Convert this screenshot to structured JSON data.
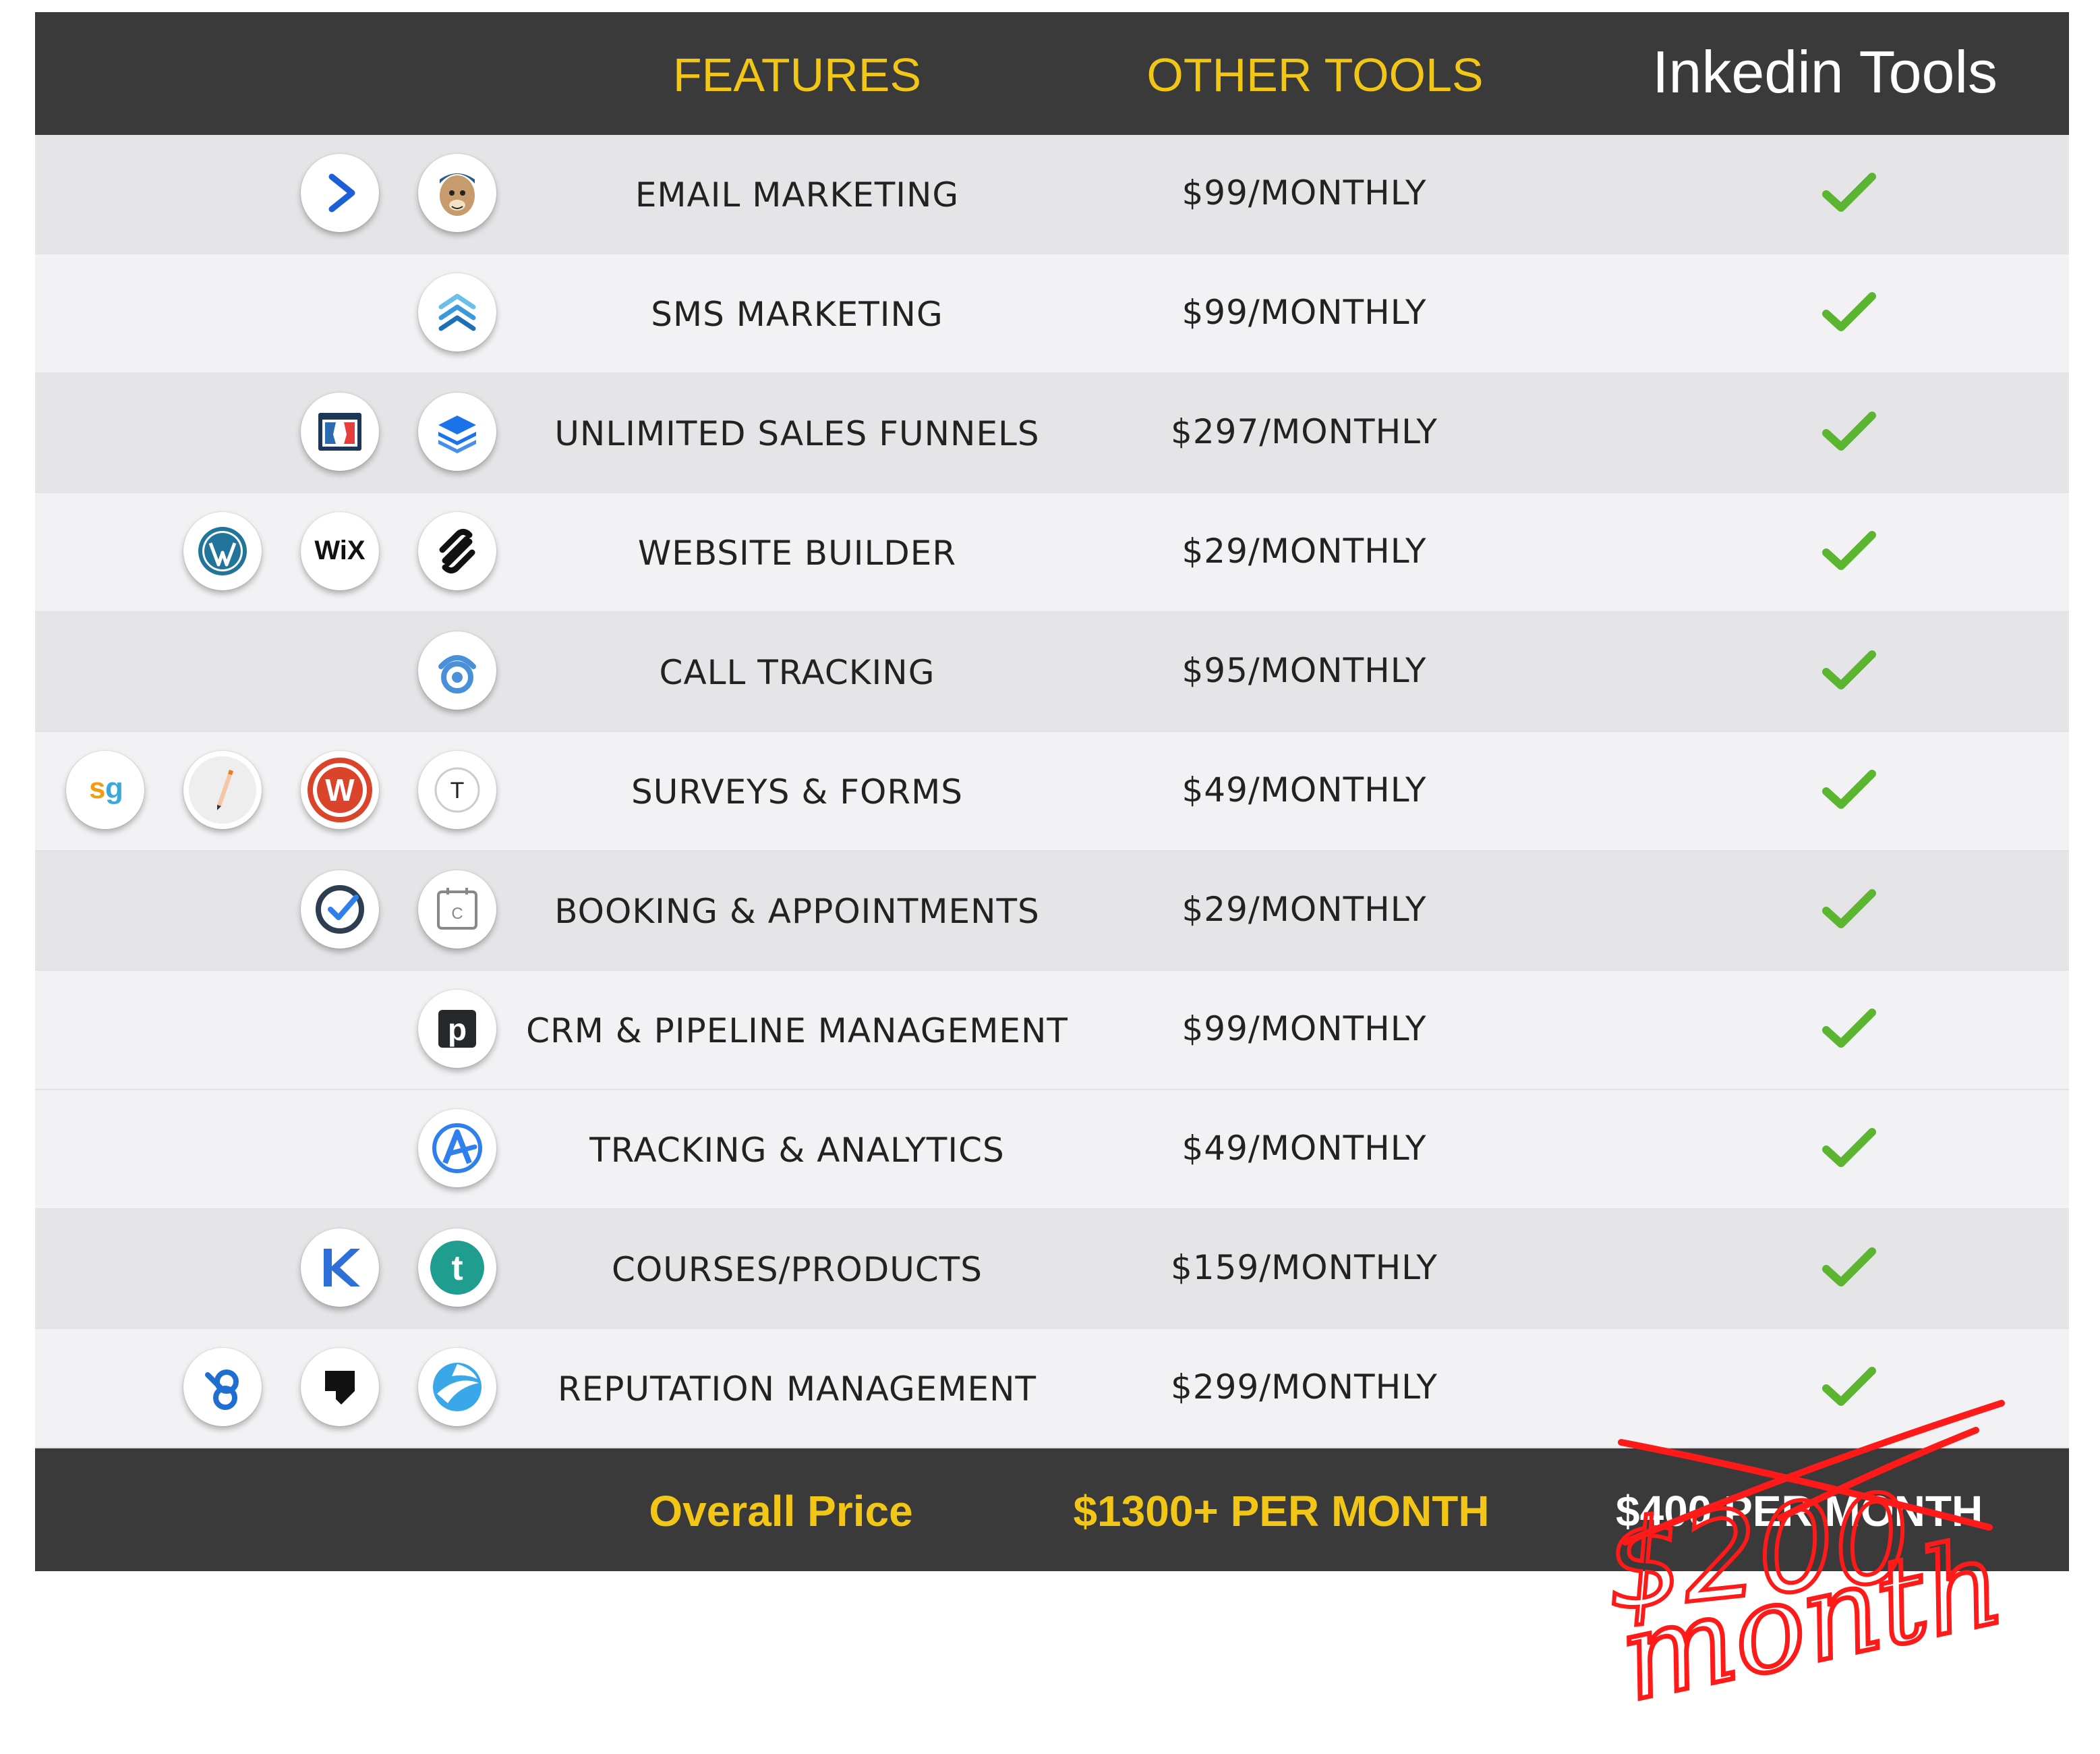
{
  "header": {
    "features": "FEATURES",
    "other_tools": "OTHER TOOLS",
    "inkedin_tools": "Inkedin Tools"
  },
  "rows": [
    {
      "feature": "EMAIL MARKETING",
      "price": "$99/MONTHLY",
      "icons": [
        "activecampaign-icon",
        "mailchimp-icon"
      ]
    },
    {
      "feature": "SMS MARKETING",
      "price": "$99/MONTHLY",
      "icons": [
        "sms-chevrons-icon"
      ]
    },
    {
      "feature": "UNLIMITED SALES FUNNELS",
      "price": "$297/MONTHLY",
      "icons": [
        "clickfunnels-icon",
        "layers-icon"
      ]
    },
    {
      "feature": "WEBSITE BUILDER",
      "price": "$29/MONTHLY",
      "icons": [
        "wordpress-icon",
        "wix-icon",
        "squarespace-icon"
      ]
    },
    {
      "feature": "CALL TRACKING",
      "price": "$95/MONTHLY",
      "icons": [
        "call-tracking-icon"
      ]
    },
    {
      "feature": "SURVEYS & FORMS",
      "price": "$49/MONTHLY",
      "icons": [
        "surveygizmo-icon",
        "pencil-icon",
        "wufoo-icon",
        "typeform-icon"
      ]
    },
    {
      "feature": "BOOKING & APPOINTMENTS",
      "price": "$29/MONTHLY",
      "icons": [
        "acuity-check-icon",
        "calendly-icon"
      ]
    },
    {
      "feature": "CRM & PIPELINE MANAGEMENT",
      "price": "$99/MONTHLY",
      "icons": [
        "pipedrive-icon"
      ]
    },
    {
      "feature": "TRACKING & ANALYTICS",
      "price": "$49/MONTHLY",
      "icons": [
        "analytics-icon"
      ]
    },
    {
      "feature": "COURSES/PRODUCTS",
      "price": "$159/MONTHLY",
      "icons": [
        "kajabi-icon",
        "teachable-icon"
      ]
    },
    {
      "feature": "REPUTATION MANAGEMENT",
      "price": "$299/MONTHLY",
      "icons": [
        "birdeye-icon",
        "podium-icon",
        "swirl-icon"
      ]
    }
  ],
  "footer": {
    "label": "Overall Price",
    "other_total": "$1300+ PER MONTH",
    "our_price": "$400 PER MONTH"
  },
  "handwritten": {
    "price": "$200",
    "unit": "month"
  },
  "colors": {
    "header_bg": "#3a3a3a",
    "accent_yellow": "#f2c617",
    "check_green": "#5cb531",
    "red_markup": "#ff1a1a",
    "row_odd": "#e5e5e8",
    "row_even": "#f2f2f4"
  }
}
